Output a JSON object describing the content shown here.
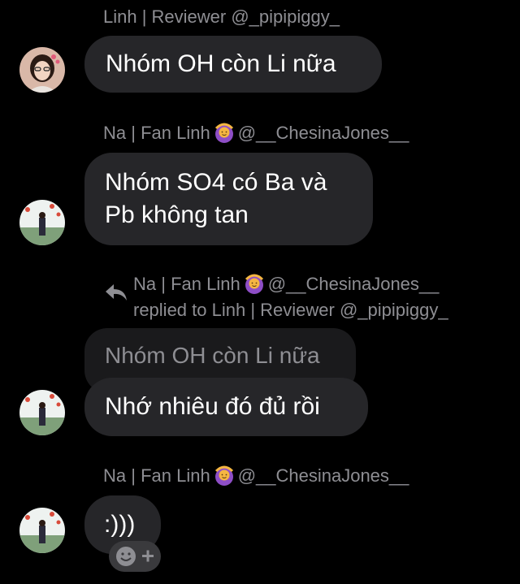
{
  "messages": [
    {
      "sender": "Linh | Reviewer @_pipipiggy_",
      "text": "Nhóm OH còn Li nữa"
    },
    {
      "sender_name": "Na | Fan Linh",
      "sender_handle": "@__ChesinaJones__",
      "sender_emoji": "woman-gesturing-ok-emoji",
      "text_line1": "Nhóm SO4 có Ba và",
      "text_line2": "Pb không tan"
    },
    {
      "reply_name": "Na | Fan Linh",
      "reply_handle": "@__ChesinaJones__",
      "reply_to": "replied to Linh | Reviewer @_pipipiggy_",
      "quoted_text": "Nhóm OH còn Li nữa",
      "text": "Nhớ nhiêu đó đủ rồi"
    },
    {
      "sender_name": "Na | Fan Linh",
      "sender_handle": "@__ChesinaJones__",
      "text": ":)))"
    }
  ],
  "colors": {
    "background": "#000000",
    "bubble": "#262629",
    "quoted_bubble": "#1a1a1c",
    "meta_text": "#8e8e93"
  },
  "icons": {
    "reply": "reply-arrow-icon",
    "react": "add-reaction-icon"
  }
}
